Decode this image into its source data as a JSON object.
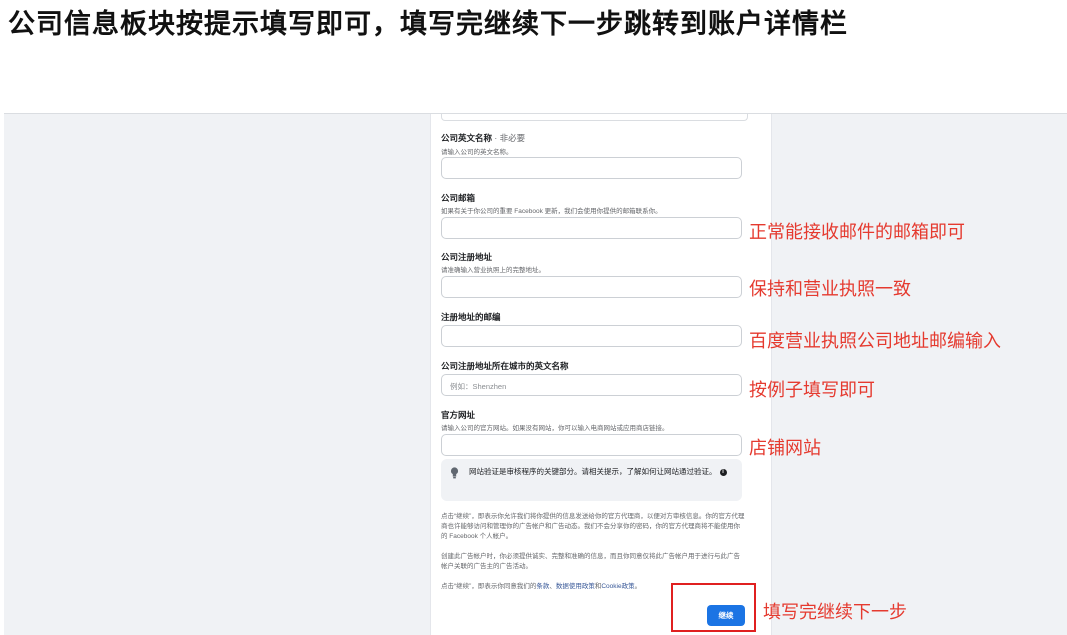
{
  "heading": "公司信息板块按提示填写即可，填写完继续下一步跳转到账户详情栏",
  "form": {
    "english_name": {
      "label": "公司英文名称",
      "optional": " · 非必要",
      "desc": "请输入公司的英文名称。",
      "value": ""
    },
    "email": {
      "label": "公司邮箱",
      "desc": "如果有关于你公司的重要 Facebook 更新，我们会使用你提供的邮箱联系你。",
      "value": ""
    },
    "address": {
      "label": "公司注册地址",
      "desc": "请准确输入营业执照上的完整地址。",
      "value": ""
    },
    "postcode": {
      "label": "注册地址的邮编",
      "value": ""
    },
    "city_en": {
      "label": "公司注册地址所在城市的英文名称",
      "placeholder": "例如：Shenzhen"
    },
    "website": {
      "label": "官方网址",
      "desc": "请输入公司的官方网站。如果没有网站，你可以输入电商网站或应用商店链接。",
      "value": ""
    },
    "tip": {
      "text": "网站验证是审核程序的关键部分。请相关提示，了解如何让网站通过验证。",
      "info_icon": "i"
    },
    "legal_1": "点击“继续”，即表示你允许我们将你提供的信息发送给你的官方代理商，以便对方审核信息。你的官方代理商也许能够访问和管理你的广告帐户和广告动态。我们不会分享你的密码，你的官方代理商将不能使用你的 Facebook 个人帐户。",
    "legal_2": "创建此广告帐户时，你必须提供诚实、完整和准确的信息，而且你同意仅将此广告帐户用于进行与此广告帐户关联的广告主的广告活动。",
    "legal_3_prefix": "点击“继续”，即表示你同意我们的",
    "legal_3_terms": "条款",
    "legal_3_sep": "、",
    "legal_3_data": "数据使用政策",
    "legal_3_and": "和",
    "legal_3_cookie": "Cookie政策",
    "legal_3_end": "。",
    "continue_label": "继续"
  },
  "annotations": {
    "email_note": "正常能接收邮件的邮箱即可",
    "address_note": "保持和营业执照一致",
    "postcode_note": "百度营业执照公司地址邮编输入",
    "city_note": "按例子填写即可",
    "website_note": "店铺网站",
    "continue_note": "填写完继续下一步"
  },
  "colors": {
    "accent": "#1b74e4",
    "annotation": "#e53a2f",
    "page_bg": "#f0f2f5"
  }
}
